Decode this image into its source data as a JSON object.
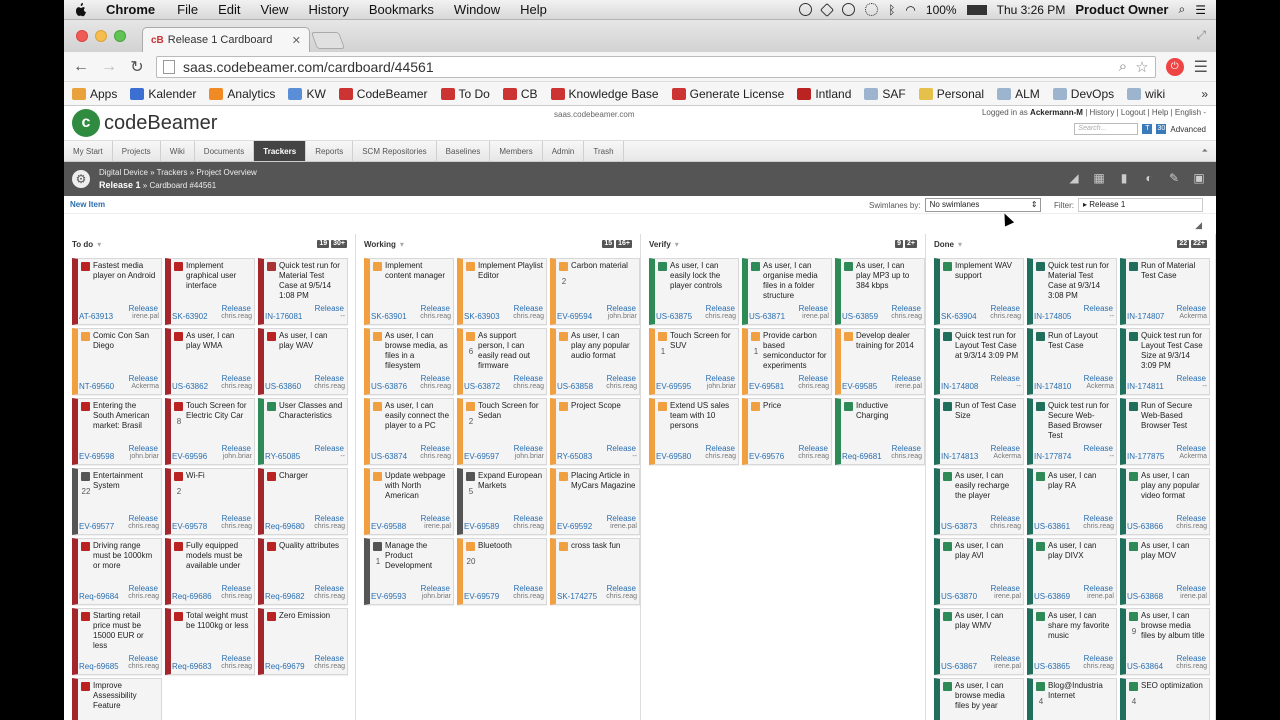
{
  "menubar": {
    "app": "Chrome",
    "items": [
      "File",
      "Edit",
      "View",
      "History",
      "Bookmarks",
      "Window",
      "Help"
    ],
    "battery": "100%",
    "clock": "Thu 3:26 PM",
    "user": "Product Owner"
  },
  "browser": {
    "tab_title": "Release 1 Cardboard",
    "tab_favicon": "cB",
    "url": "saas.codebeamer.com/cardboard/44561",
    "bookmarks": [
      {
        "label": "Apps",
        "color": "#e9a13b"
      },
      {
        "label": "Kalender",
        "color": "#3b6fd1"
      },
      {
        "label": "Analytics",
        "color": "#f08a24"
      },
      {
        "label": "KW",
        "color": "#5a8fd8"
      },
      {
        "label": "CodeBeamer",
        "color": "#c33"
      },
      {
        "label": "To Do",
        "color": "#c33"
      },
      {
        "label": "CB",
        "color": "#c33"
      },
      {
        "label": "Knowledge Base",
        "color": "#c33"
      },
      {
        "label": "Generate License",
        "color": "#c33"
      },
      {
        "label": "Intland",
        "color": "#b22"
      },
      {
        "label": "SAF",
        "color": "#9db4cf"
      },
      {
        "label": "Personal",
        "color": "#e5c04a"
      },
      {
        "label": "ALM",
        "color": "#9db4cf"
      },
      {
        "label": "DevOps",
        "color": "#9db4cf"
      },
      {
        "label": "wiki",
        "color": "#9db4cf"
      }
    ],
    "more": "»"
  },
  "cb": {
    "logo": "codeBeamer",
    "host": "saas.codebeamer.com",
    "login_prefix": "Logged in as",
    "login_user": "Ackermann-M",
    "login_links": "| History | Logout | Help | English -",
    "search_placeholder": "Search...",
    "advanced": "Advanced",
    "nav": [
      "My Start",
      "Projects",
      "Wiki",
      "Documents",
      "Trackers",
      "Reports",
      "SCM Repositories",
      "Baselines",
      "Members",
      "Admin",
      "Trash"
    ],
    "nav_active": "Trackers",
    "crumb_line1": "Digital Device » Trackers » Project Overview",
    "crumb_release": "Release 1",
    "crumb_rest": "» Cardboard #44561",
    "new_item": "New Item",
    "swimlanes_label": "Swimlanes by:",
    "swimlanes_value": "No swimlanes",
    "filter_label": "Filter:",
    "filter_value": "Release 1"
  },
  "columns": [
    {
      "name": "To do",
      "b1": "19",
      "b2": "30+",
      "cards": [
        {
          "t": "Fastest media player on Android",
          "id": "AT-63913",
          "o": "irene.pal",
          "c": "#a3262d",
          "i": "#b22",
          "s": ""
        },
        {
          "t": "Implement graphical user interface",
          "id": "SK-63902",
          "o": "chris.reag",
          "c": "#a3262d",
          "i": "#b22",
          "s": ""
        },
        {
          "t": "Quick test run for Material Test Case at 9/5/14 1:08 PM",
          "id": "IN-176081",
          "o": "--",
          "c": "#a3262d",
          "i": "#a33",
          "s": ""
        },
        {
          "t": "Comic Con San Diego",
          "id": "NT-69560",
          "o": "Ackerma",
          "c": "#f0a040",
          "i": "#f0a040",
          "s": ""
        },
        {
          "t": "As user, I can play WMA",
          "id": "US-63862",
          "o": "chris.reag",
          "c": "#a3262d",
          "i": "#b22",
          "s": ""
        },
        {
          "t": "As user, I can play WAV",
          "id": "US-63860",
          "o": "chris.reag",
          "c": "#a3262d",
          "i": "#b22",
          "s": ""
        },
        {
          "t": "Entering the South American market: Brasil",
          "id": "EV-69598",
          "o": "john.briar",
          "c": "#a3262d",
          "i": "#b22",
          "s": ""
        },
        {
          "t": "Touch Screen for Electric City Car",
          "id": "EV-69596",
          "o": "john.briar",
          "c": "#a3262d",
          "i": "#b22",
          "s": "8"
        },
        {
          "t": "User Classes and Characteristics",
          "id": "RY-65085",
          "o": "--",
          "c": "#2e8b57",
          "i": "#2e8b57",
          "s": ""
        },
        {
          "t": "Entertainment System",
          "id": "EV-69577",
          "o": "chris.reag",
          "c": "#555",
          "i": "#555",
          "s": "22"
        },
        {
          "t": "Wi-Fi",
          "id": "EV-69578",
          "o": "chris.reag",
          "c": "#a3262d",
          "i": "#b22",
          "s": "2"
        },
        {
          "t": "Charger",
          "id": "Req-69680",
          "o": "chris.reag",
          "c": "#a3262d",
          "i": "#b22",
          "s": ""
        },
        {
          "t": "Driving range must be 1000km or more",
          "id": "Req-69684",
          "o": "chris.reag",
          "c": "#a3262d",
          "i": "#b22",
          "s": ""
        },
        {
          "t": "Fully equipped models must be available under",
          "id": "Req-69686",
          "o": "chris.reag",
          "c": "#a3262d",
          "i": "#b22",
          "s": ""
        },
        {
          "t": "Quality attributes",
          "id": "Req-69682",
          "o": "chris.reag",
          "c": "#a3262d",
          "i": "#b22",
          "s": ""
        },
        {
          "t": "Starting retail price must be 15000 EUR or less",
          "id": "Req-69685",
          "o": "chris.reag",
          "c": "#a3262d",
          "i": "#b22",
          "s": ""
        },
        {
          "t": "Total weight must be 1100kg or less",
          "id": "Req-69683",
          "o": "chris.reag",
          "c": "#a3262d",
          "i": "#b22",
          "s": ""
        },
        {
          "t": "Zero Emission",
          "id": "Req-69679",
          "o": "chris.reag",
          "c": "#a3262d",
          "i": "#b22",
          "s": ""
        },
        {
          "t": "Improve Assessibility Feature",
          "id": "",
          "o": "",
          "c": "#a3262d",
          "i": "#b22",
          "s": ""
        }
      ]
    },
    {
      "name": "Working",
      "b1": "15",
      "b2": "16+",
      "cards": [
        {
          "t": "Implement content manager",
          "id": "SK-63901",
          "o": "chris.reag",
          "c": "#f0a040",
          "i": "#f0a040",
          "s": ""
        },
        {
          "t": "Implement Playlist Editor",
          "id": "SK-63903",
          "o": "chris.reag",
          "c": "#f0a040",
          "i": "#f0a040",
          "s": ""
        },
        {
          "t": "Carbon material",
          "id": "EV-69594",
          "o": "john.briar",
          "c": "#f0a040",
          "i": "#f0a040",
          "s": "2"
        },
        {
          "t": "As user, I can browse media, as files in a filesystem",
          "id": "US-63876",
          "o": "chris.reag",
          "c": "#f0a040",
          "i": "#f0a040",
          "s": ""
        },
        {
          "t": "As support person, I can easily read out firmware",
          "id": "US-63872",
          "o": "chris.reag",
          "c": "#f0a040",
          "i": "#f0a040",
          "s": "6"
        },
        {
          "t": "As user, I can play any popular audio format",
          "id": "US-63858",
          "o": "chris.reag",
          "c": "#f0a040",
          "i": "#f0a040",
          "s": ""
        },
        {
          "t": "As user, I can easily connect the player to a PC",
          "id": "US-63874",
          "o": "chris.reag",
          "c": "#f0a040",
          "i": "#f0a040",
          "s": ""
        },
        {
          "t": "Touch Screen for Sedan",
          "id": "EV-69597",
          "o": "john.briar",
          "c": "#f0a040",
          "i": "#f0a040",
          "s": "2"
        },
        {
          "t": "Project Scope",
          "id": "RY-65083",
          "o": "--",
          "c": "#f0a040",
          "i": "#f0a040",
          "s": ""
        },
        {
          "t": "Update webpage with North American",
          "id": "EV-69588",
          "o": "irene.pal",
          "c": "#f0a040",
          "i": "#f0a040",
          "s": ""
        },
        {
          "t": "Expand European Markets",
          "id": "EV-69589",
          "o": "chris.reag",
          "c": "#555",
          "i": "#555",
          "s": "5"
        },
        {
          "t": "Placing Article in MyCars Magazine",
          "id": "EV-69592",
          "o": "irene.pal",
          "c": "#f0a040",
          "i": "#f0a040",
          "s": ""
        },
        {
          "t": "Manage the Product Development",
          "id": "EV-69593",
          "o": "john.briar",
          "c": "#555",
          "i": "#555",
          "s": "1"
        },
        {
          "t": "Bluetooth",
          "id": "EV-69579",
          "o": "chris.reag",
          "c": "#f0a040",
          "i": "#f0a040",
          "s": "20"
        },
        {
          "t": "cross task fun",
          "id": "SK-174275",
          "o": "chris.reag",
          "c": "#f0a040",
          "i": "#f0a040",
          "s": ""
        }
      ]
    },
    {
      "name": "Verify",
      "b1": "9",
      "b2": "2+",
      "cards": [
        {
          "t": "As user, I can easily lock the player controls",
          "id": "US-63875",
          "o": "chris.reag",
          "c": "#2e8b57",
          "i": "#2e8b57",
          "s": ""
        },
        {
          "t": "As user, I can organise media files in a folder structure",
          "id": "US-63871",
          "o": "irene.pal",
          "c": "#2e8b57",
          "i": "#2e8b57",
          "s": ""
        },
        {
          "t": "As user, I can play MP3 up to 384 kbps",
          "id": "US-63859",
          "o": "chris.reag",
          "c": "#2e8b57",
          "i": "#2e8b57",
          "s": ""
        },
        {
          "t": "Touch Screen for SUV",
          "id": "EV-69595",
          "o": "john.briar",
          "c": "#f0a040",
          "i": "#f0a040",
          "s": "1"
        },
        {
          "t": "Provide carbon based semiconductor for experiments",
          "id": "EV-69581",
          "o": "chris.reag",
          "c": "#f0a040",
          "i": "#f0a040",
          "s": "1"
        },
        {
          "t": "Develop dealer training for 2014",
          "id": "EV-69585",
          "o": "irene.pal",
          "c": "#f0a040",
          "i": "#f0a040",
          "s": ""
        },
        {
          "t": "Extend US sales team with 10 persons",
          "id": "EV-69580",
          "o": "chris.reag",
          "c": "#f0a040",
          "i": "#f0a040",
          "s": ""
        },
        {
          "t": "Price",
          "id": "EV-69576",
          "o": "chris.reag",
          "c": "#f0a040",
          "i": "#f0a040",
          "s": ""
        },
        {
          "t": "Inductive Charging",
          "id": "Req-69681",
          "o": "chris.reag",
          "c": "#2e8b57",
          "i": "#2e8b57",
          "s": ""
        }
      ]
    },
    {
      "name": "Done",
      "b1": "22",
      "b2": "22+",
      "cards": [
        {
          "t": "Implement WAV support",
          "id": "SK-63904",
          "o": "chris.reag",
          "c": "#1f6f5c",
          "i": "#2e8b57",
          "s": ""
        },
        {
          "t": "Quick test run for Material Test Case at 9/3/14 3:08 PM",
          "id": "IN-174805",
          "o": "--",
          "c": "#1f6f5c",
          "i": "#1f6f5c",
          "s": ""
        },
        {
          "t": "Run of Material Test Case",
          "id": "IN-174807",
          "o": "Ackerma",
          "c": "#1f6f5c",
          "i": "#1f6f5c",
          "s": ""
        },
        {
          "t": "Quick test run for Layout Test Case at 9/3/14 3:09 PM",
          "id": "IN-174808",
          "o": "--",
          "c": "#1f6f5c",
          "i": "#1f6f5c",
          "s": ""
        },
        {
          "t": "Run of Layout Test Case",
          "id": "IN-174810",
          "o": "Ackerma",
          "c": "#1f6f5c",
          "i": "#1f6f5c",
          "s": ""
        },
        {
          "t": "Quick test run for Layout Test Case Size at 9/3/14 3:09 PM",
          "id": "IN-174811",
          "o": "--",
          "c": "#1f6f5c",
          "i": "#1f6f5c",
          "s": ""
        },
        {
          "t": "Run of Test Case Size",
          "id": "IN-174813",
          "o": "Ackerma",
          "c": "#1f6f5c",
          "i": "#1f6f5c",
          "s": ""
        },
        {
          "t": "Quick test run for Secure Web-Based Browser Test",
          "id": "IN-177874",
          "o": "--",
          "c": "#1f6f5c",
          "i": "#1f6f5c",
          "s": ""
        },
        {
          "t": "Run of Secure Web-Based Browser Test",
          "id": "IN-177875",
          "o": "Ackerma",
          "c": "#1f6f5c",
          "i": "#1f6f5c",
          "s": ""
        },
        {
          "t": "As user, I can easily recharge the player",
          "id": "US-63873",
          "o": "chris.reag",
          "c": "#1f6f5c",
          "i": "#2e8b57",
          "s": ""
        },
        {
          "t": "As user, I can play RA",
          "id": "US-63861",
          "o": "chris.reag",
          "c": "#1f6f5c",
          "i": "#2e8b57",
          "s": ""
        },
        {
          "t": "As user, I can play any popular video format",
          "id": "US-63866",
          "o": "chris.reag",
          "c": "#1f6f5c",
          "i": "#2e8b57",
          "s": ""
        },
        {
          "t": "As user, I can play AVI",
          "id": "US-63870",
          "o": "irene.pal",
          "c": "#1f6f5c",
          "i": "#2e8b57",
          "s": ""
        },
        {
          "t": "As user, I can play DIVX",
          "id": "US-63869",
          "o": "irene.pal",
          "c": "#1f6f5c",
          "i": "#2e8b57",
          "s": ""
        },
        {
          "t": "As user, I can play MOV",
          "id": "US-63868",
          "o": "irene.pal",
          "c": "#1f6f5c",
          "i": "#2e8b57",
          "s": ""
        },
        {
          "t": "As user, I can play WMV",
          "id": "US-63867",
          "o": "irene.pal",
          "c": "#1f6f5c",
          "i": "#2e8b57",
          "s": ""
        },
        {
          "t": "As user, I can share my favorite music",
          "id": "US-63865",
          "o": "chris.reag",
          "c": "#1f6f5c",
          "i": "#2e8b57",
          "s": ""
        },
        {
          "t": "As user, I can browse media files by album title",
          "id": "US-63864",
          "o": "chris.reag",
          "c": "#1f6f5c",
          "i": "#2e8b57",
          "s": "9"
        },
        {
          "t": "As user, I can browse media files by year",
          "id": "",
          "o": "",
          "c": "#1f6f5c",
          "i": "#2e8b57",
          "s": ""
        },
        {
          "t": "Blog@Industria Internet",
          "id": "",
          "o": "",
          "c": "#1f6f5c",
          "i": "#2e8b57",
          "s": "4"
        },
        {
          "t": "SEO optimization",
          "id": "",
          "o": "",
          "c": "#1f6f5c",
          "i": "#2e8b57",
          "s": "4"
        }
      ]
    }
  ],
  "release_label": "Release"
}
